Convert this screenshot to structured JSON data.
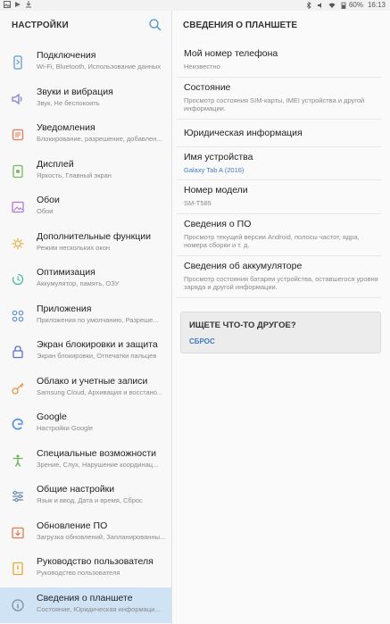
{
  "status_bar": {
    "battery": "60%",
    "time": "16:13"
  },
  "left": {
    "title": "НАСТРОЙКИ",
    "items": [
      {
        "title": "Подключения",
        "sub": "Wi-Fi, Bluetooth, Использование данных",
        "icon": "connections-icon",
        "color": "#5aa0d8"
      },
      {
        "title": "Звуки и вибрация",
        "sub": "Звук, Не беспокоить",
        "icon": "sound-icon",
        "color": "#7b7fd6"
      },
      {
        "title": "Уведомления",
        "sub": "Блокирование, разрешение, добавлен...",
        "icon": "notifications-icon",
        "color": "#e57a5a"
      },
      {
        "title": "Дисплей",
        "sub": "Яркость, Главный экран",
        "icon": "display-icon",
        "color": "#7cb85b"
      },
      {
        "title": "Обои",
        "sub": "Обои",
        "icon": "wallpaper-icon",
        "color": "#b07ad0"
      },
      {
        "title": "Дополнительные функции",
        "sub": "Режим нескольких окон",
        "icon": "advanced-features-icon",
        "color": "#e6b246"
      },
      {
        "title": "Оптимизация",
        "sub": "Аккумулятор, память, ОЗУ",
        "icon": "optimization-icon",
        "color": "#4db8a5"
      },
      {
        "title": "Приложения",
        "sub": "Приложения по умолчанию, Разреше...",
        "icon": "apps-icon",
        "color": "#5d8fd6"
      },
      {
        "title": "Экран блокировки и защита",
        "sub": "Экран блокировки, Отпечатки пальцев",
        "icon": "lock-icon",
        "color": "#5a72c8"
      },
      {
        "title": "Облако и учетные записи",
        "sub": "Samsung Cloud, Архивация и восстано...",
        "icon": "key-icon",
        "color": "#e8964a"
      },
      {
        "title": "Google",
        "sub": "Настройки Google",
        "icon": "google-icon",
        "color": "#4a8be0"
      },
      {
        "title": "Специальные возможности",
        "sub": "Зрение, Слух, Нарушение координац...",
        "icon": "accessibility-icon",
        "color": "#69b350"
      },
      {
        "title": "Общие настройки",
        "sub": "Язык и ввод, Дата и время, Сброс",
        "icon": "general-settings-icon",
        "color": "#6a8bb0"
      },
      {
        "title": "Обновление ПО",
        "sub": "Загрузка обновлений, Запланированны...",
        "icon": "software-update-icon",
        "color": "#e47b4d"
      },
      {
        "title": "Руководство пользователя",
        "sub": "Руководство пользователя",
        "icon": "manual-icon",
        "color": "#e5a93a"
      },
      {
        "title": "Сведения о планшете",
        "sub": "Состояние, Юридическая информаци...",
        "icon": "info-icon",
        "color": "#7d8fa3"
      }
    ]
  },
  "right": {
    "title": "СВЕДЕНИЯ О ПЛАНШЕТЕ",
    "items": [
      {
        "title": "Мой номер телефона",
        "sub": "Неизвестно",
        "blue": false
      },
      {
        "title": "Состояние",
        "sub": "Просмотр состояния SIM-карты, IMEI устройства и другой информации.",
        "blue": false
      },
      {
        "title": "Юридическая информация",
        "sub": "",
        "blue": false
      },
      {
        "title": "Имя устройства",
        "sub": "Galaxy Tab A (2016)",
        "blue": true
      },
      {
        "title": "Номер модели",
        "sub": "SM-T585",
        "blue": false
      },
      {
        "title": "Сведения о ПО",
        "sub": "Просмотр текущей версии Android, полосы частот, ядра, номера сборки и т. д.",
        "blue": false
      },
      {
        "title": "Сведения об аккумуляторе",
        "sub": "Просмотр состояния батареи устройства, оставшегося уровня заряда и другой информации.",
        "blue": false
      }
    ],
    "card": {
      "title": "ИЩЕТЕ ЧТО-ТО ДРУГОЕ?",
      "link": "СБРОС"
    }
  },
  "colors": {
    "accent": "#3d7cc4",
    "active_bg": "#cfe3f5"
  }
}
